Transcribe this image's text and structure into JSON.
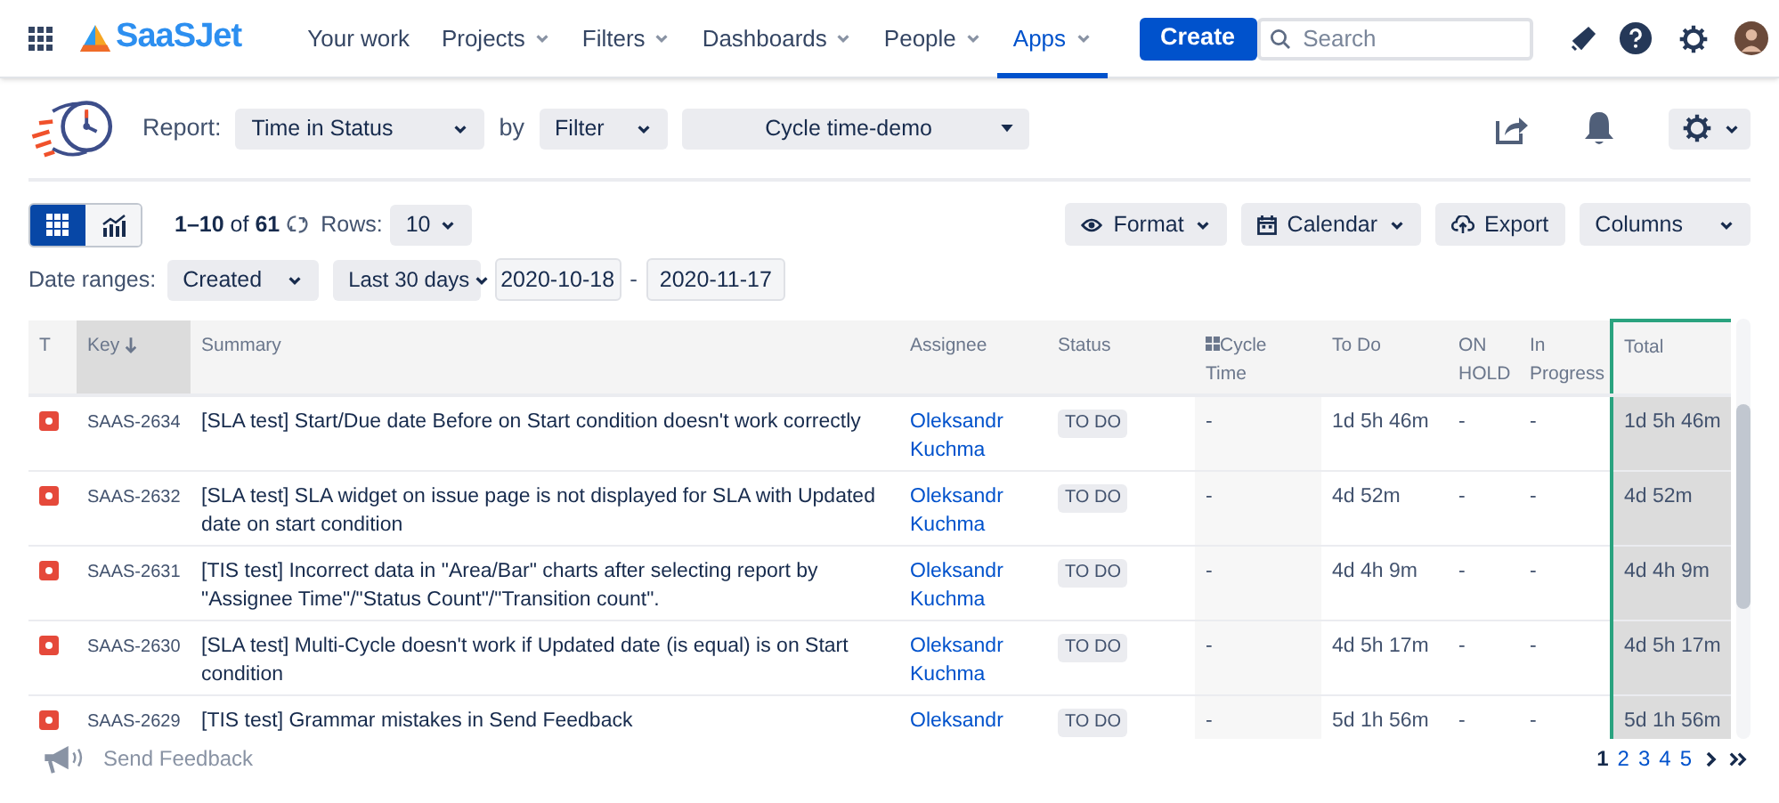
{
  "nav": {
    "logo": "SaaSJet",
    "items": [
      {
        "label": "Your work",
        "dropdown": false,
        "selected": false
      },
      {
        "label": "Projects",
        "dropdown": true,
        "selected": false
      },
      {
        "label": "Filters",
        "dropdown": true,
        "selected": false
      },
      {
        "label": "Dashboards",
        "dropdown": true,
        "selected": false
      },
      {
        "label": "People",
        "dropdown": true,
        "selected": false
      },
      {
        "label": "Apps",
        "dropdown": true,
        "selected": true
      }
    ],
    "create": "Create",
    "search": {
      "placeholder": "Search"
    }
  },
  "report": {
    "label": "Report:",
    "type": "Time in Status",
    "by": "by",
    "source": "Filter",
    "filter": "Cycle time-demo"
  },
  "views": [
    {
      "kind": "grid",
      "selected": true
    },
    {
      "kind": "chart",
      "selected": false
    }
  ],
  "range": "**1–10** of **61**",
  "rows_label": "Rows:",
  "rows_value": "10",
  "actions": [
    {
      "label": "Format",
      "kind": "eye",
      "dropdown": true
    },
    {
      "label": "Calendar",
      "kind": "calendar",
      "dropdown": true
    },
    {
      "label": "Export",
      "kind": "cloud",
      "dropdown": false
    },
    {
      "label": "Columns",
      "kind": "plain",
      "dropdown": true
    }
  ],
  "date_ranges": {
    "label": "Date ranges:",
    "field": "Created",
    "period": "Last 30 days",
    "from": "2020-10-18",
    "separator": "-",
    "to": "2020-11-17"
  },
  "table": {
    "columns": [
      {
        "label": "T",
        "sorted": false,
        "highlighted": false
      },
      {
        "label": "Key",
        "sorted": true,
        "highlighted": false
      },
      {
        "label": "Summary",
        "sorted": false,
        "highlighted": false
      },
      {
        "label": "Assignee",
        "sorted": false,
        "highlighted": false
      },
      {
        "label": "Status",
        "sorted": false,
        "highlighted": false
      },
      {
        "label": "Cycle Time",
        "sorted": false,
        "highlighted": false
      },
      {
        "label": "To Do",
        "sorted": false,
        "highlighted": false
      },
      {
        "label": "ON HOLD",
        "sorted": false,
        "highlighted": false
      },
      {
        "label": "In Progress",
        "sorted": false,
        "highlighted": false
      },
      {
        "label": "Total",
        "sorted": false,
        "highlighted": true
      }
    ],
    "rows": [
      {
        "key": "SAAS-2634",
        "summary": "[SLA test] Start/Due date Before on Start condition doesn't work correctly",
        "assignee": "Oleksandr Kuchma",
        "status": "TO DO",
        "cycle_time": "-",
        "to_do": "1d 5h 46m",
        "on_hold": "-",
        "in_progress": "-",
        "total": "1d 5h 46m"
      },
      {
        "key": "SAAS-2632",
        "summary": "[SLA test] SLA widget on issue page is not displayed for SLA with Updated date on start condition",
        "assignee": "Oleksandr Kuchma",
        "status": "TO DO",
        "cycle_time": "-",
        "to_do": "4d 52m",
        "on_hold": "-",
        "in_progress": "-",
        "total": "4d 52m"
      },
      {
        "key": "SAAS-2631",
        "summary": "[TIS test] Incorrect data in \"Area/Bar\" charts after selecting report by \"Assignee Time\"/\"Status Count\"/\"Transition count\".",
        "assignee": "Oleksandr Kuchma",
        "status": "TO DO",
        "cycle_time": "-",
        "to_do": "4d 4h 9m",
        "on_hold": "-",
        "in_progress": "-",
        "total": "4d 4h 9m"
      },
      {
        "key": "SAAS-2630",
        "summary": "[SLA test] Multi-Cycle doesn't work if Updated date (is equal) is on Start condition",
        "assignee": "Oleksandr Kuchma",
        "status": "TO DO",
        "cycle_time": "-",
        "to_do": "4d 5h 17m",
        "on_hold": "-",
        "in_progress": "-",
        "total": "4d 5h 17m"
      },
      {
        "key": "SAAS-2629",
        "summary": "[TIS test] Grammar mistakes in Send Feedback",
        "assignee": "Oleksandr",
        "status": "TO DO",
        "cycle_time": "-",
        "to_do": "5d 1h 56m",
        "on_hold": "-",
        "in_progress": "-",
        "total": "5d 1h 56m"
      }
    ]
  },
  "feedback": "Send Feedback",
  "pages": [
    {
      "label": "1",
      "selected": true
    },
    {
      "label": "2",
      "selected": false
    },
    {
      "label": "3",
      "selected": false
    },
    {
      "label": "4",
      "selected": false
    },
    {
      "label": "5",
      "selected": false
    }
  ]
}
